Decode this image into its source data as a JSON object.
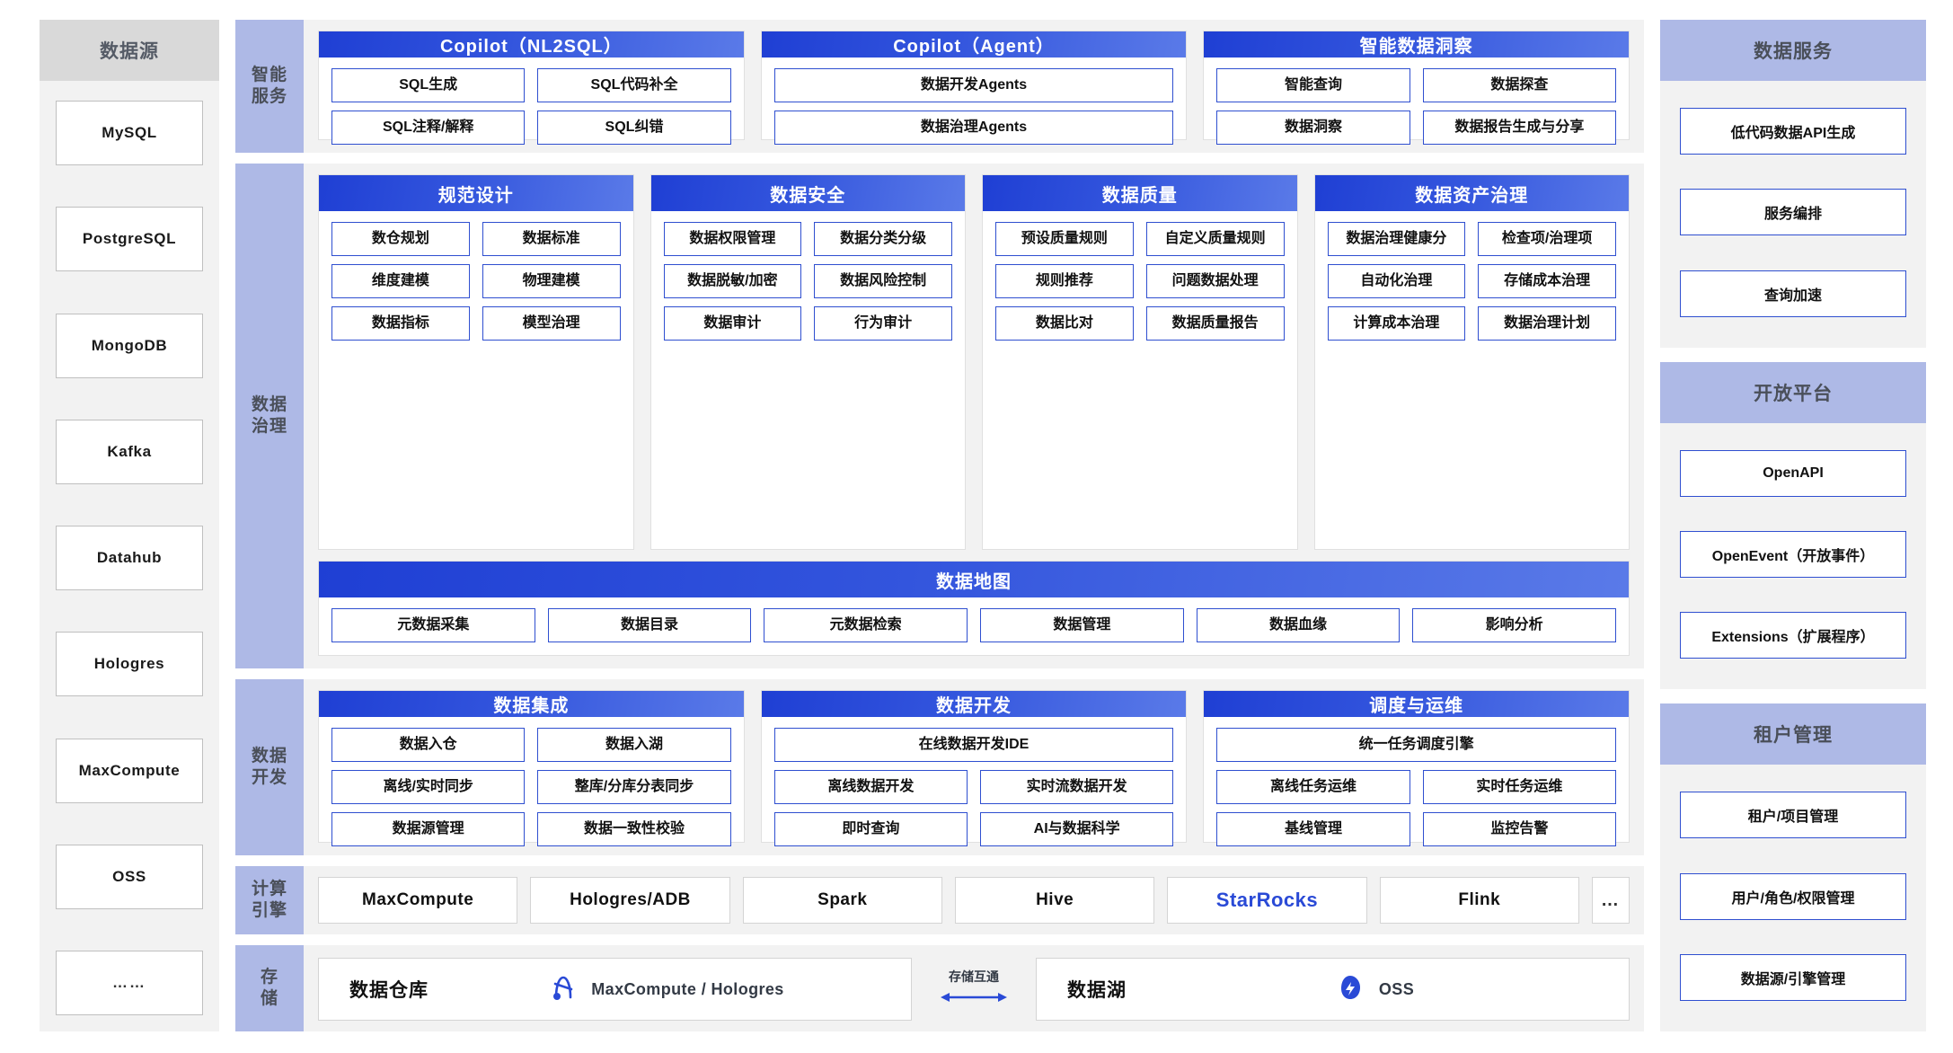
{
  "datasource": {
    "title": "数据源",
    "items": [
      "MySQL",
      "PostgreSQL",
      "MongoDB",
      "Kafka",
      "Datahub",
      "Hologres",
      "MaxCompute",
      "OSS",
      "……"
    ]
  },
  "bands": {
    "smart_service": {
      "label": "智能\n服务",
      "label_line1": "智能",
      "label_line2": "服务",
      "cards": [
        {
          "title": "Copilot（NL2SQL）",
          "items": [
            "SQL生成",
            "SQL代码补全",
            "SQL注释/解释",
            "SQL纠错"
          ]
        },
        {
          "title": "Copilot（Agent）",
          "items": [
            "数据开发Agents",
            "数据治理Agents"
          ]
        },
        {
          "title": "智能数据洞察",
          "items": [
            "智能查询",
            "数据探查",
            "数据洞察",
            "数据报告生成与分享"
          ]
        }
      ]
    },
    "data_governance": {
      "label_line1": "数据",
      "label_line2": "治理",
      "cards": [
        {
          "title": "规范设计",
          "items": [
            "数仓规划",
            "数据标准",
            "维度建模",
            "物理建模",
            "数据指标",
            "模型治理"
          ]
        },
        {
          "title": "数据安全",
          "items": [
            "数据权限管理",
            "数据分类分级",
            "数据脱敏/加密",
            "数据风险控制",
            "数据审计",
            "行为审计"
          ]
        },
        {
          "title": "数据质量",
          "items": [
            "预设质量规则",
            "自定义质量规则",
            "规则推荐",
            "问题数据处理",
            "数据比对",
            "数据质量报告"
          ]
        },
        {
          "title": "数据资产治理",
          "items": [
            "数据治理健康分",
            "检查项/治理项",
            "自动化治理",
            "存储成本治理",
            "计算成本治理",
            "数据治理计划"
          ]
        }
      ],
      "map_card": {
        "title": "数据地图",
        "items": [
          "元数据采集",
          "数据目录",
          "元数据检索",
          "数据管理",
          "数据血缘",
          "影响分析"
        ]
      }
    },
    "data_development": {
      "label_line1": "数据",
      "label_line2": "开发",
      "cards": [
        {
          "title": "数据集成",
          "items": [
            "数据入仓",
            "数据入湖",
            "离线/实时同步",
            "整库/分库分表同步",
            "数据源管理",
            "数据一致性校验"
          ]
        },
        {
          "title": "数据开发",
          "wide_first": true,
          "items": [
            "在线数据开发IDE",
            "离线数据开发",
            "实时流数据开发",
            "即时查询",
            "AI与数据科学"
          ]
        },
        {
          "title": "调度与运维",
          "wide_first": true,
          "items": [
            "统一任务调度引擎",
            "离线任务运维",
            "实时任务运维",
            "基线管理",
            "监控告警"
          ]
        }
      ]
    },
    "compute_engine": {
      "label_line1": "计算",
      "label_line2": "引擎",
      "engines": [
        "MaxCompute",
        "Hologres/ADB",
        "Spark",
        "Hive",
        "StarRocks",
        "Flink"
      ],
      "accent_engine": "StarRocks",
      "accent_color": "#2a4ad6",
      "more": "…"
    },
    "storage": {
      "label_line1": "存",
      "label_line2": "储",
      "warehouse": {
        "title": "数据仓库",
        "engine": "MaxCompute / Hologres",
        "icon": "maxcompute-logo"
      },
      "lake": {
        "title": "数据湖",
        "engine": "OSS",
        "icon": "oss-cloud-logo"
      },
      "interlink": {
        "text": "存储互通",
        "icon": "bidirectional-arrow"
      }
    }
  },
  "right_panels": [
    {
      "title": "数据服务",
      "items": [
        "低代码数据API生成",
        "服务编排",
        "查询加速"
      ]
    },
    {
      "title": "开放平台",
      "items": [
        "OpenAPI",
        "OpenEvent（开放事件）",
        "Extensions（扩展程序）"
      ]
    },
    {
      "title": "租户管理",
      "items": [
        "租户/项目管理",
        "用户/角色/权限管理",
        "数据源/引擎管理"
      ]
    }
  ]
}
